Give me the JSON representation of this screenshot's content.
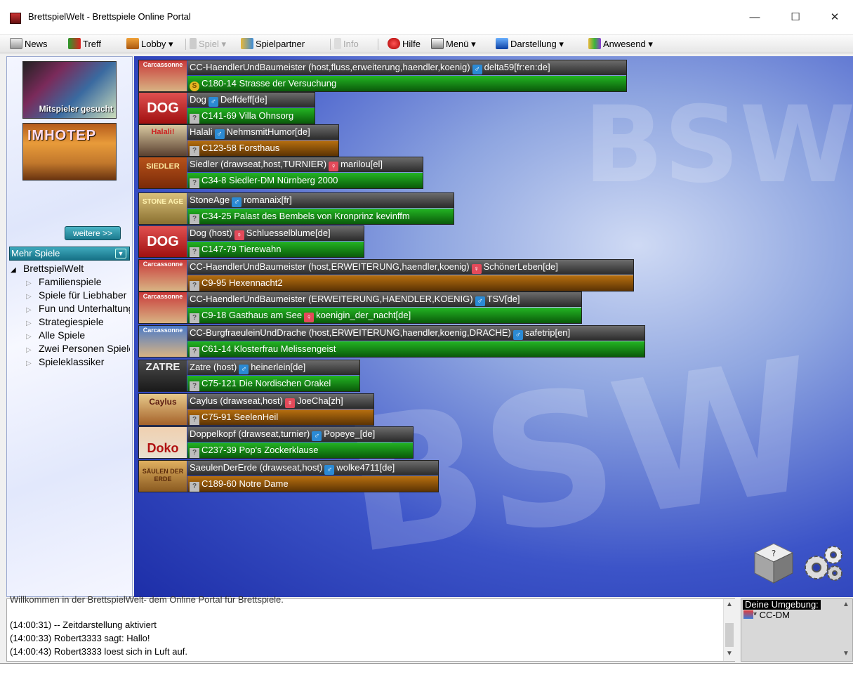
{
  "window": {
    "title": "BrettspielWelt - Brettspiele Online Portal",
    "min_glyph": "—",
    "max_glyph": "☐",
    "close_glyph": "✕"
  },
  "toolbar": {
    "items": [
      {
        "label": "News",
        "icon": "news-icon",
        "disabled": false
      },
      {
        "label": "Treff",
        "icon": "treff-icon",
        "disabled": false
      },
      {
        "label": "Lobby ▾",
        "icon": "lobby-icon",
        "disabled": false
      },
      {
        "label": "Spiel ▾",
        "icon": "spiel-icon",
        "disabled": true
      },
      {
        "label": "Spielpartner",
        "icon": "spielpartner-icon",
        "disabled": false
      },
      {
        "label": "Info",
        "icon": "info-icon",
        "disabled": true
      },
      {
        "label": "Hilfe",
        "icon": "hilfe-icon",
        "disabled": false
      },
      {
        "label": "Menü ▾",
        "icon": "menu-icon",
        "disabled": false
      },
      {
        "label": "Darstellung ▾",
        "icon": "darstellung-icon",
        "disabled": false
      },
      {
        "label": "Anwesend ▾",
        "icon": "anwesend-icon",
        "disabled": false
      }
    ]
  },
  "sidebar": {
    "promo_mitspieler": "Mitspieler gesucht",
    "promo_imhotep": "IMHOTEP",
    "weitere_label": "weitere >>",
    "mehr_spiele_label": "Mehr Spiele",
    "tree_root": "BrettspielWelt",
    "tree_children": [
      "Familienspiele",
      "Spiele für Liebhaber",
      "Fun und Unterhaltung",
      "Strategiespiele",
      "Alle Spiele",
      "Zwei Personen Spiele",
      "Spieleklassiker"
    ]
  },
  "rooms": [
    {
      "thumb": "Carcassonne",
      "game": "CC-HaendlerUndBaumeister (host,fluss,erweiterung,haendler,koenig)",
      "gender": "m",
      "player": "delta59[fr:en:de]",
      "badge": "S",
      "room": "C180-14 Strasse der Versuchung",
      "status": "green"
    },
    {
      "thumb": "DOG",
      "game": "Dog",
      "gender": "m",
      "player": "Deffdeff[de]",
      "badge": "?",
      "room": "C141-69 Villa Ohnsorg",
      "status": "green"
    },
    {
      "thumb": "Halali!",
      "game": "Halali",
      "gender": "m",
      "player": "NehmsmitHumor[de]",
      "badge": "?",
      "room": "C123-58 Forsthaus",
      "status": "orange"
    },
    {
      "thumb": "SIEDLER",
      "game": "Siedler (drawseat,host,TURNIER)",
      "gender": "f",
      "player": "marilou[el]",
      "badge": "?",
      "room": "C34-8 Siedler-DM Nürnberg 2000",
      "status": "green"
    },
    {
      "thumb": "STONE AGE",
      "game": "StoneAge",
      "gender": "m",
      "player": "romanaix[fr]",
      "badge": "?",
      "room": "C34-25 Palast des Bembels von Kronprinz kevinffm",
      "status": "green"
    },
    {
      "thumb": "DOG",
      "game": "Dog (host)",
      "gender": "f",
      "player": "Schluesselblume[de]",
      "badge": "?",
      "room": "C147-79 Tierewahn",
      "status": "green"
    },
    {
      "thumb": "Carcassonne",
      "game": "CC-HaendlerUndBaumeister (host,ERWEITERUNG,haendler,koenig)",
      "gender": "f",
      "player": "SchönerLeben[de]",
      "badge": "?",
      "room": "C9-95 Hexennacht2",
      "status": "orange"
    },
    {
      "thumb": "Carcassonne",
      "game": "CC-HaendlerUndBaumeister (ERWEITERUNG,HAENDLER,KOENIG)",
      "gender": "m",
      "player": "TSV[de]",
      "badge": "?",
      "room": "C9-18 Gasthaus am See",
      "room_gender": "f",
      "room_player": "koenigin_der_nacht[de]",
      "status": "green"
    },
    {
      "thumb": "Carcassonne",
      "game": "CC-BurgfraeuleinUndDrache (host,ERWEITERUNG,haendler,koenig,DRACHE)",
      "gender": "m",
      "player": "safetrip[en]",
      "badge": "?",
      "room": "C61-14 Klosterfrau Melissengeist",
      "status": "green"
    },
    {
      "thumb": "ZATRE",
      "game": "Zatre (host)",
      "gender": "m",
      "player": "heinerlein[de]",
      "badge": "?",
      "room": "C75-121 Die Nordischen Orakel",
      "status": "green"
    },
    {
      "thumb": "Caylus",
      "game": "Caylus (drawseat,host)",
      "gender": "f",
      "player": "JoeCha[zh]",
      "badge": "?",
      "room": "C75-91 SeelenHeil",
      "status": "orange"
    },
    {
      "thumb": "Doko",
      "game": "Doppelkopf (drawseat,turnier)",
      "gender": "m",
      "player": "Popeye_[de]",
      "badge": "?",
      "room": "C237-39 Pop's Zockerklause",
      "status": "green"
    },
    {
      "thumb": "SÄULEN DER ERDE",
      "game": "SaeulenDerErde (drawseat,host)",
      "gender": "m",
      "player": "wolke4711[de]",
      "badge": "?",
      "room": "C189-60 Notre Dame",
      "status": "orange"
    }
  ],
  "chat": {
    "lines": [
      "Willkommen in der BrettspielWelt- dem Online Portal für Brettspiele.",
      "(14:00:31) -- Zeitdarstellung aktiviert",
      "(14:00:33) Robert3333 sagt: Hallo!",
      "(14:00:43) Robert3333 loest sich in Luft auf."
    ]
  },
  "environment": {
    "title": "Deine Umgebung:",
    "item": "* CC-DM"
  },
  "colors": {
    "room_green": "#1a9a1a",
    "room_orange": "#a0600c",
    "male": "#2b8ad4",
    "female": "#e34a5a"
  }
}
